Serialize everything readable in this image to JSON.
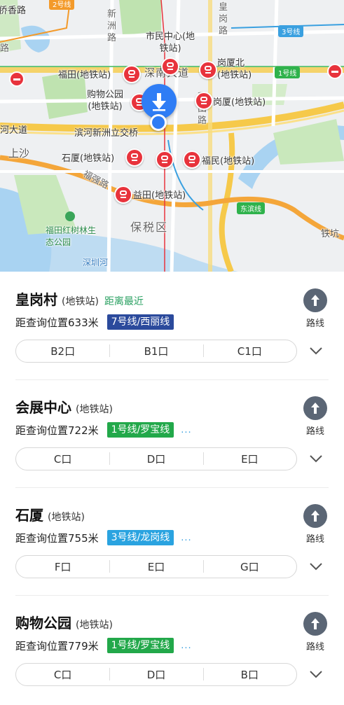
{
  "map": {
    "labels": {
      "qiaoxiang": "侨香路",
      "xinzhou": "新洲路",
      "huanggang": "皇岗路",
      "lu_left": "路",
      "shenzhen_blvd": "深南大道",
      "caitian": "彩田路",
      "binhe_left": "河大道",
      "binhe_overpass": "滨河新洲立交桥",
      "shangsha": "上沙",
      "fuqiang": "福强路",
      "baoshui": "保税区",
      "park": "福田红树林生态公园",
      "shenzhen_river": "深圳河",
      "tiekeng": "铁坑"
    },
    "badges": {
      "line2": "2号线",
      "line3": "3号线",
      "line1": "1号线",
      "dongbin": "东滨线"
    },
    "stations": {
      "shiminzhongxin": "市民中心(地铁站)",
      "futian": "福田(地铁站)",
      "gangxiabei": "岗厦北(地铁站)",
      "gouwugongyuan": "购物公园(地铁站)",
      "gangxia": "岗厦(地铁站)",
      "shixia": "石厦(地铁站)",
      "fumin": "福民(地铁站)",
      "yitian": "益田(地铁站)"
    }
  },
  "stations": [
    {
      "name": "皇岗村",
      "type": "(地铁站)",
      "tag": "距离最近",
      "distance": "距查询位置633米",
      "line": "7号线/西丽线",
      "line_color": "#2b4a9c",
      "more": "",
      "route_label": "路线",
      "exits": [
        "B2口",
        "B1口",
        "C1口"
      ]
    },
    {
      "name": "会展中心",
      "type": "(地铁站)",
      "tag": "",
      "distance": "距查询位置722米",
      "line": "1号线/罗宝线",
      "line_color": "#22a84a",
      "more": "...",
      "route_label": "路线",
      "exits": [
        "C口",
        "D口",
        "E口"
      ]
    },
    {
      "name": "石厦",
      "type": "(地铁站)",
      "tag": "",
      "distance": "距查询位置755米",
      "line": "3号线/龙岗线",
      "line_color": "#2aa3e0",
      "more": "...",
      "route_label": "路线",
      "exits": [
        "F口",
        "E口",
        "G口"
      ]
    },
    {
      "name": "购物公园",
      "type": "(地铁站)",
      "tag": "",
      "distance": "距查询位置779米",
      "line": "1号线/罗宝线",
      "line_color": "#22a84a",
      "more": "...",
      "route_label": "路线",
      "exits": [
        "C口",
        "D口",
        "B口"
      ]
    }
  ]
}
